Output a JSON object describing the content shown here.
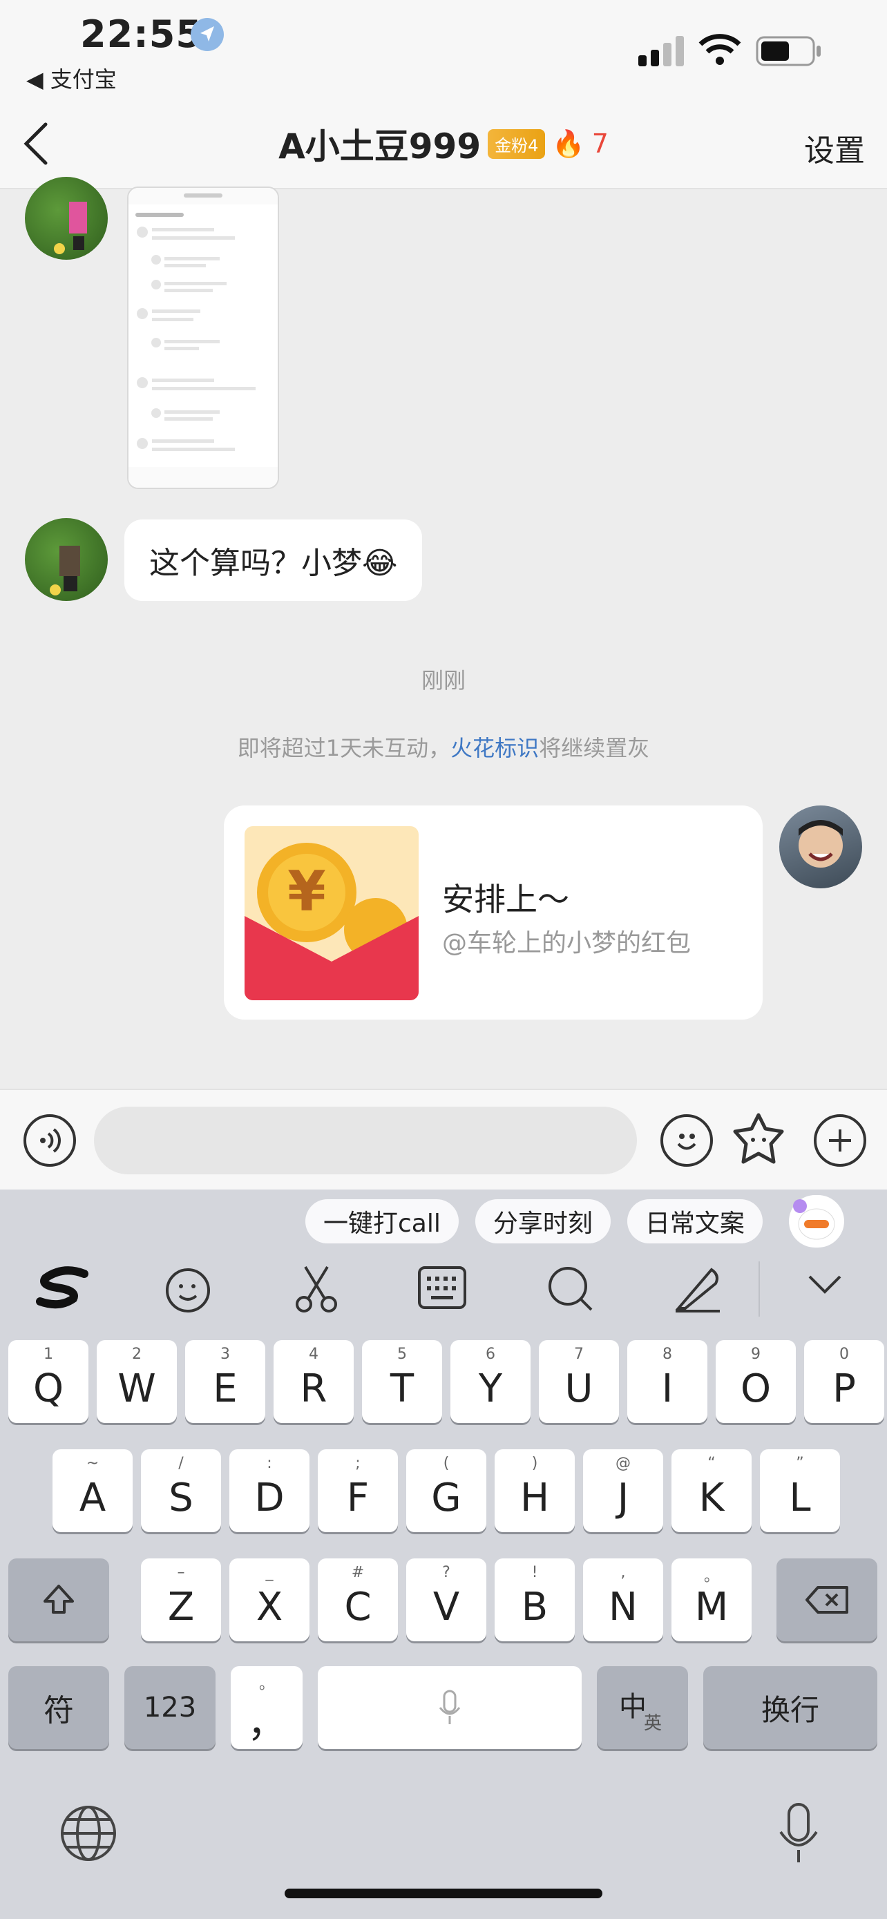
{
  "status": {
    "time": "22:55",
    "back_app": "◀ 支付宝"
  },
  "nav": {
    "title": "A小土豆999",
    "fan_badge": "金粉4",
    "streak_count": "7",
    "settings_label": "设置"
  },
  "chat": {
    "bubble_text": "这个算吗？小梦😂",
    "time_label": "刚刚",
    "notice_prefix": "即将超过1天未互动，",
    "notice_link": "火花标识",
    "notice_suffix": "将继续置灰",
    "red_packet": {
      "title": "安排上～",
      "subtitle": "@车轮上的小梦的红包"
    }
  },
  "keyboard": {
    "chips": [
      "一键打call",
      "分享时刻",
      "日常文案"
    ],
    "row1": [
      {
        "k": "Q",
        "h": "1"
      },
      {
        "k": "W",
        "h": "2"
      },
      {
        "k": "E",
        "h": "3"
      },
      {
        "k": "R",
        "h": "4"
      },
      {
        "k": "T",
        "h": "5"
      },
      {
        "k": "Y",
        "h": "6"
      },
      {
        "k": "U",
        "h": "7"
      },
      {
        "k": "I",
        "h": "8"
      },
      {
        "k": "O",
        "h": "9"
      },
      {
        "k": "P",
        "h": "0"
      }
    ],
    "row2": [
      {
        "k": "A",
        "h": "~"
      },
      {
        "k": "S",
        "h": "/"
      },
      {
        "k": "D",
        "h": ":"
      },
      {
        "k": "F",
        "h": ";"
      },
      {
        "k": "G",
        "h": "("
      },
      {
        "k": "H",
        "h": ")"
      },
      {
        "k": "J",
        "h": "@"
      },
      {
        "k": "K",
        "h": "“"
      },
      {
        "k": "L",
        "h": "”"
      }
    ],
    "row3": [
      {
        "k": "Z",
        "h": "–"
      },
      {
        "k": "X",
        "h": "_"
      },
      {
        "k": "C",
        "h": "#"
      },
      {
        "k": "V",
        "h": "?"
      },
      {
        "k": "B",
        "h": "!"
      },
      {
        "k": "N",
        "h": ","
      },
      {
        "k": "M",
        "h": "。"
      }
    ],
    "symbols_label": "符",
    "numbers_label": "123",
    "punct_label": "，",
    "punct_hint": "。",
    "lang_label": "中",
    "lang_sub": "英",
    "return_label": "换行"
  }
}
